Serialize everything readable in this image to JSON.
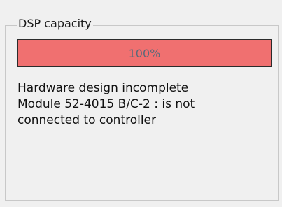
{
  "group": {
    "title": "DSP capacity"
  },
  "capacity": {
    "percent_label": "100%",
    "fraction": 1.0,
    "fill_color": "#f07070"
  },
  "status": {
    "lines": [
      "Hardware design incomplete",
      "Module 52-4015 B/C-2 : is not",
      "connected to controller"
    ]
  }
}
